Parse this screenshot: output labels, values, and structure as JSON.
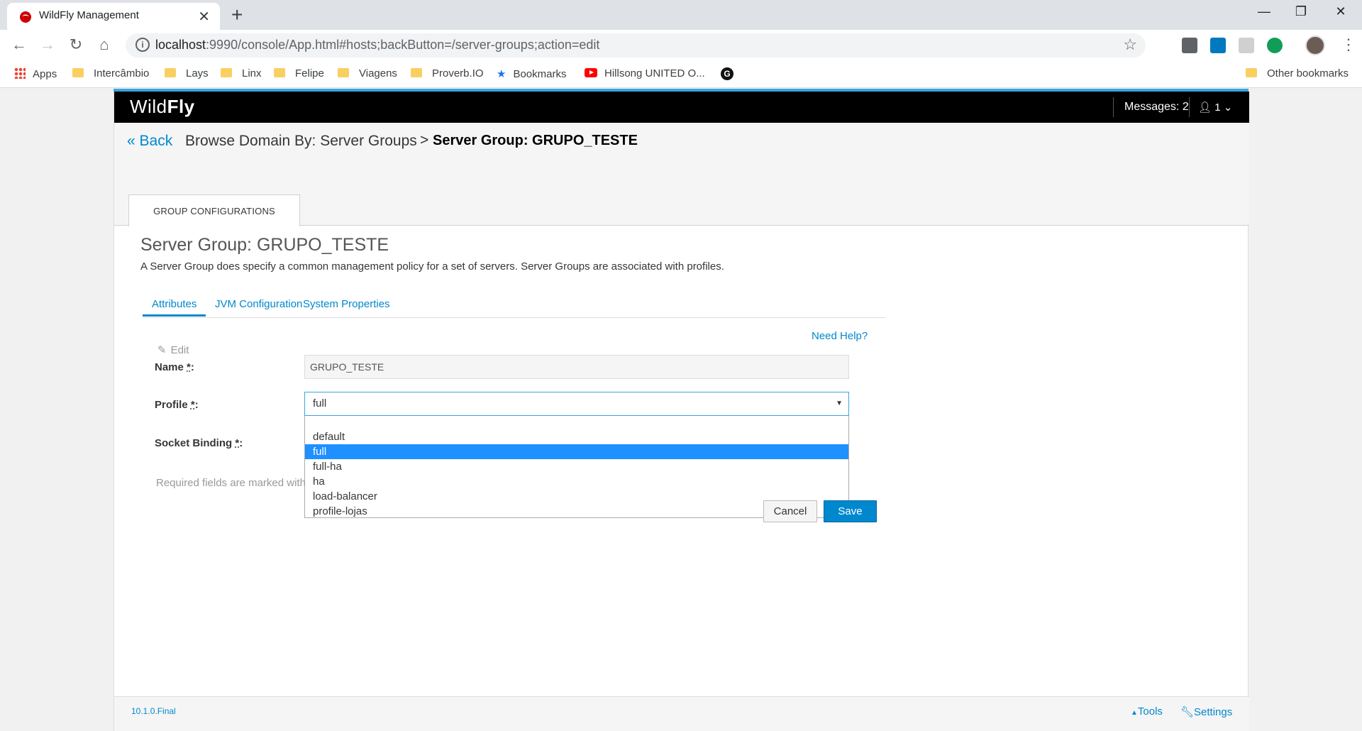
{
  "browser": {
    "tab_title": "WildFly Management",
    "url_host": "localhost",
    "url_rest": ":9990/console/App.html#hosts;backButton=/server-groups;action=edit",
    "bookmarks": [
      "Apps",
      "Intercâmbio",
      "Lays",
      "Linx",
      "Felipe",
      "Viagens",
      "Proverb.IO",
      "Bookmarks",
      "Hillsong UNITED O...",
      "G",
      "Other bookmarks"
    ]
  },
  "masthead": {
    "brand_light": "Wild",
    "brand_bold": "Fly",
    "messages": "Messages: 2",
    "user": "1"
  },
  "breadcrumb": {
    "back": "Back",
    "browse": "Browse Domain By: Server Groups",
    "separator": ">",
    "current": "Server Group: GRUPO_TESTE"
  },
  "config_tab": "GROUP CONFIGURATIONS",
  "content": {
    "title": "Server Group: GRUPO_TESTE",
    "description": "A Server Group does specify a common management policy for a set of servers. Server Groups are associated with profiles.",
    "tabs": [
      "Attributes",
      "JVM Configuration",
      "System Properties"
    ],
    "need_help": "Need Help?",
    "edit": "Edit"
  },
  "form": {
    "name_label": "Name",
    "name_value": "GRUPO_TESTE",
    "profile_label": "Profile",
    "profile_value": "full",
    "profile_options": [
      "default",
      "full",
      "full-ha",
      "ha",
      "load-balancer",
      "profile-lojas"
    ],
    "profile_selected_index": 1,
    "socket_label": "Socket Binding",
    "required_marker": "*",
    "required_note": "Required fields are marked with",
    "cancel": "Cancel",
    "save": "Save"
  },
  "footer": {
    "version": "10.1.0.Final",
    "tools": "Tools",
    "settings": "Settings"
  },
  "colors": {
    "accent": "#0088ce",
    "selected_option": "#1e90ff",
    "masthead": "#000000"
  }
}
